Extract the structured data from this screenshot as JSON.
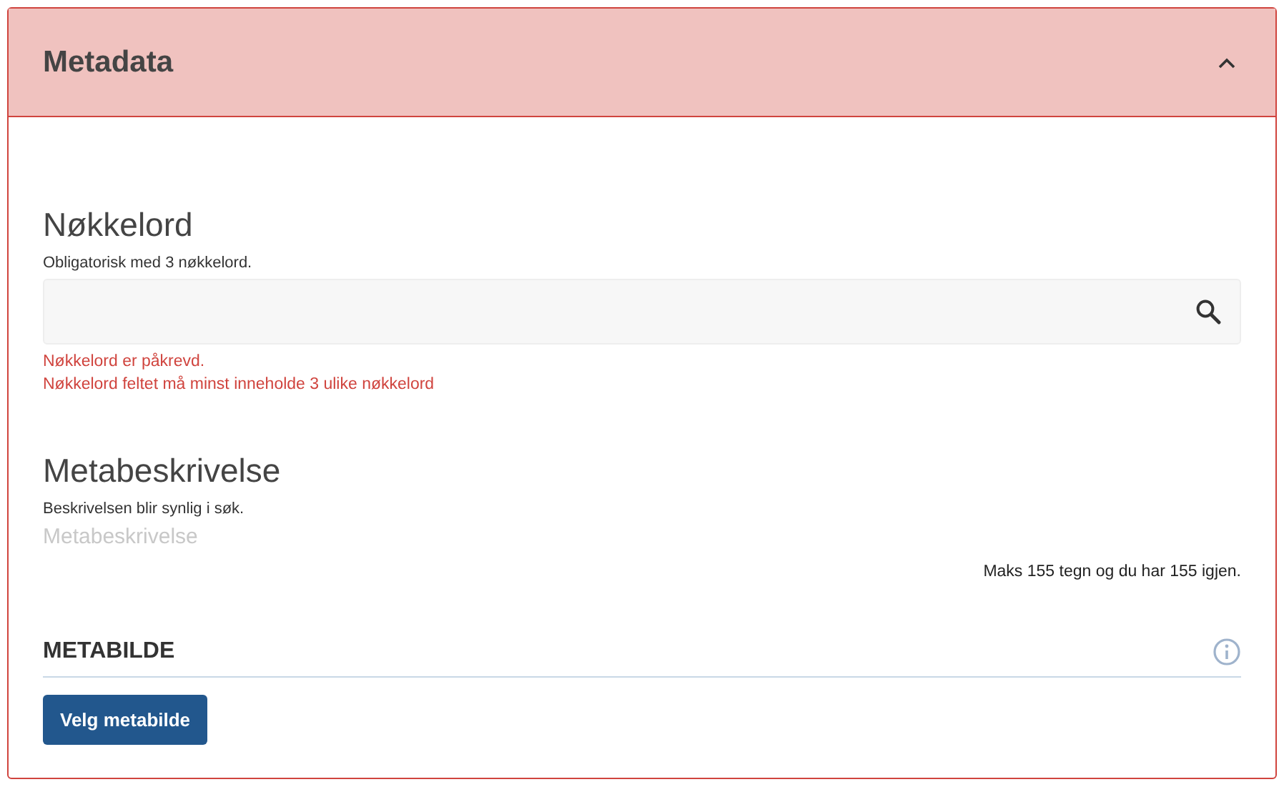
{
  "panel": {
    "title": "Metadata",
    "expanded": true
  },
  "keywords": {
    "heading": "Nøkkelord",
    "hint": "Obligatorisk med 3 nøkkelord.",
    "errors": [
      "Nøkkelord er påkrevd.",
      "Nøkkelord feltet må minst inneholde 3 ulike nøkkelord"
    ]
  },
  "description": {
    "heading": "Metabeskrivelse",
    "hint": "Beskrivelsen blir synlig i søk.",
    "placeholder": "Metabeskrivelse",
    "counter": "Maks 155 tegn og du har 155 igjen."
  },
  "image": {
    "heading": "METABILDE",
    "button": "Velg metabilde"
  }
}
